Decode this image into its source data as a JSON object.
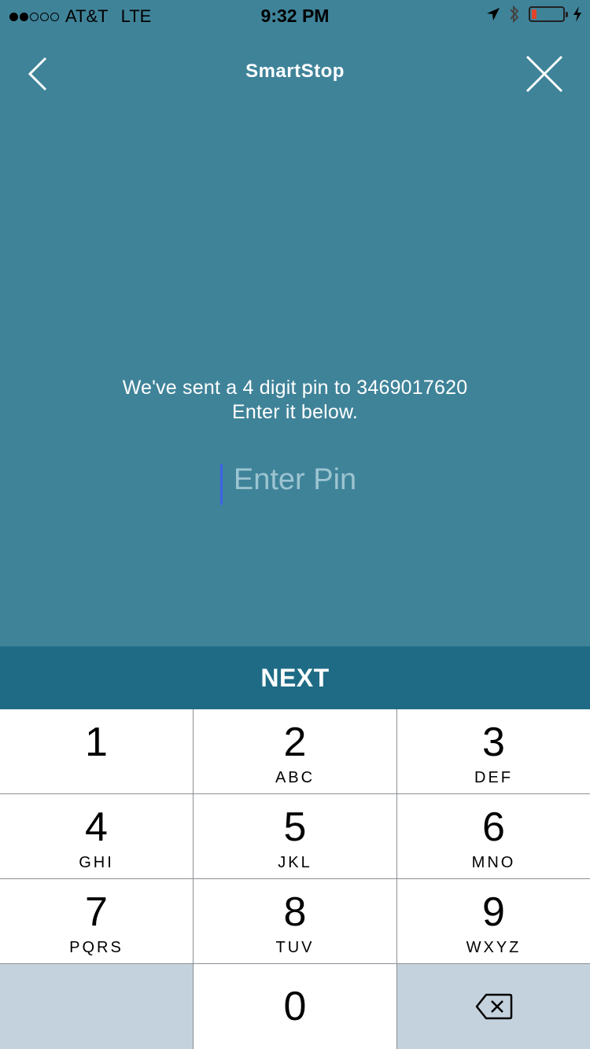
{
  "status_bar": {
    "signal_dots": [
      "filled",
      "filled",
      "empty",
      "empty",
      "empty"
    ],
    "carrier": "AT&T",
    "network": "LTE",
    "time": "9:32 PM",
    "icons": [
      "location-icon",
      "bluetooth-icon",
      "battery-icon",
      "charging-icon"
    ],
    "battery_level": 0.1,
    "battery_color": "#e2442b"
  },
  "header": {
    "brand": "SmartStop",
    "back_icon": "chevron-left-icon",
    "close_icon": "close-icon"
  },
  "message": {
    "line1": "We've sent a 4 digit pin to 3469017620",
    "line2": "Enter it below."
  },
  "pin": {
    "placeholder": "Enter Pin",
    "value": ""
  },
  "next_label": "NEXT",
  "keypad": {
    "keys": [
      {
        "num": "1",
        "letters": ""
      },
      {
        "num": "2",
        "letters": "ABC"
      },
      {
        "num": "3",
        "letters": "DEF"
      },
      {
        "num": "4",
        "letters": "GHI"
      },
      {
        "num": "5",
        "letters": "JKL"
      },
      {
        "num": "6",
        "letters": "MNO"
      },
      {
        "num": "7",
        "letters": "PQRS"
      },
      {
        "num": "8",
        "letters": "TUV"
      },
      {
        "num": "9",
        "letters": "WXYZ"
      },
      {
        "num": "0",
        "letters": ""
      }
    ],
    "delete_icon": "backspace-icon"
  },
  "colors": {
    "background": "#3f8399",
    "next_bar": "#1f6b85",
    "keypad_gray": "#c3d2dc",
    "cursor": "#3a63e6"
  }
}
